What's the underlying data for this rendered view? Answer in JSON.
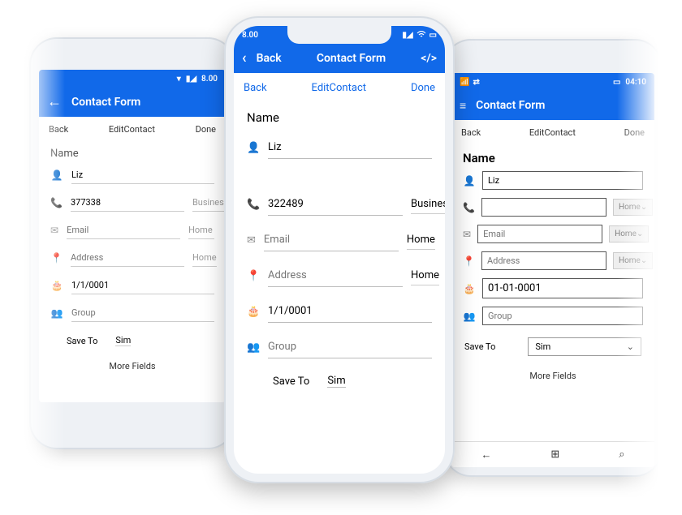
{
  "android": {
    "status": {
      "time": "8.00"
    },
    "appbar": {
      "title": "Contact Form"
    },
    "nav": {
      "back": "Back",
      "mid": "EditContact",
      "done": "Done"
    },
    "section": "Name",
    "name": "Liz",
    "phone": {
      "value": "377338",
      "type": "Business"
    },
    "email": {
      "placeholder": "Email",
      "type": "Home"
    },
    "address": {
      "placeholder": "Address",
      "type": "Home"
    },
    "date": "1/1/0001",
    "group": {
      "placeholder": "Group"
    },
    "saveTo": {
      "label": "Save To",
      "value": "Sim"
    },
    "more": "More Fields"
  },
  "iphone": {
    "status": {
      "time": "8.00"
    },
    "appbar": {
      "back": "Back",
      "title": "Contact Form",
      "code": "</>"
    },
    "nav": {
      "back": "Back",
      "mid": "EditContact",
      "done": "Done"
    },
    "section": "Name",
    "name": "Liz",
    "phone": {
      "value": "322489",
      "type": "Business"
    },
    "email": {
      "placeholder": "Email",
      "type": "Home"
    },
    "address": {
      "placeholder": "Address",
      "type": "Home"
    },
    "date": "1/1/0001",
    "group": {
      "placeholder": "Group"
    },
    "saveTo": {
      "label": "Save To",
      "value": "Sim"
    }
  },
  "windows": {
    "status": {
      "time": "04:10"
    },
    "appbar": {
      "title": "Contact Form"
    },
    "nav": {
      "back": "Back",
      "mid": "EditContact",
      "done": "Done"
    },
    "section": "Name",
    "name": "Liz",
    "phone": {
      "value": "",
      "type": "Home"
    },
    "email": {
      "placeholder": "Email",
      "type": "Home"
    },
    "address": {
      "placeholder": "Address",
      "type": "Home"
    },
    "date": "01-01-0001",
    "group": {
      "placeholder": "Group"
    },
    "saveTo": {
      "label": "Save To",
      "value": "Sim"
    },
    "more": "More Fields"
  }
}
